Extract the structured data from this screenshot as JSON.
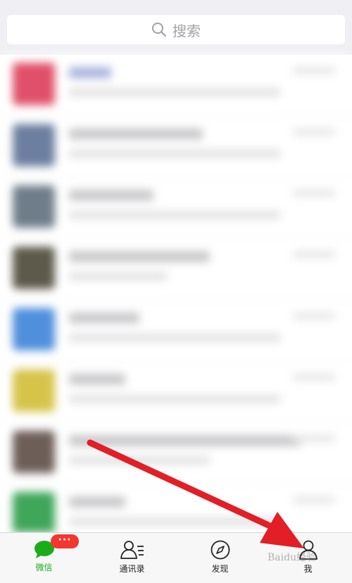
{
  "search": {
    "placeholder": "搜索"
  },
  "tabbar": {
    "chats_label": "微信",
    "chats_badge": "···",
    "contacts_label": "通讯录",
    "discover_label": "发现",
    "me_label": "我"
  },
  "colors": {
    "active_tab": "#1aad19",
    "badge": "#f43530",
    "arrow": "#e21f26"
  },
  "watermark": "Baidu经验"
}
